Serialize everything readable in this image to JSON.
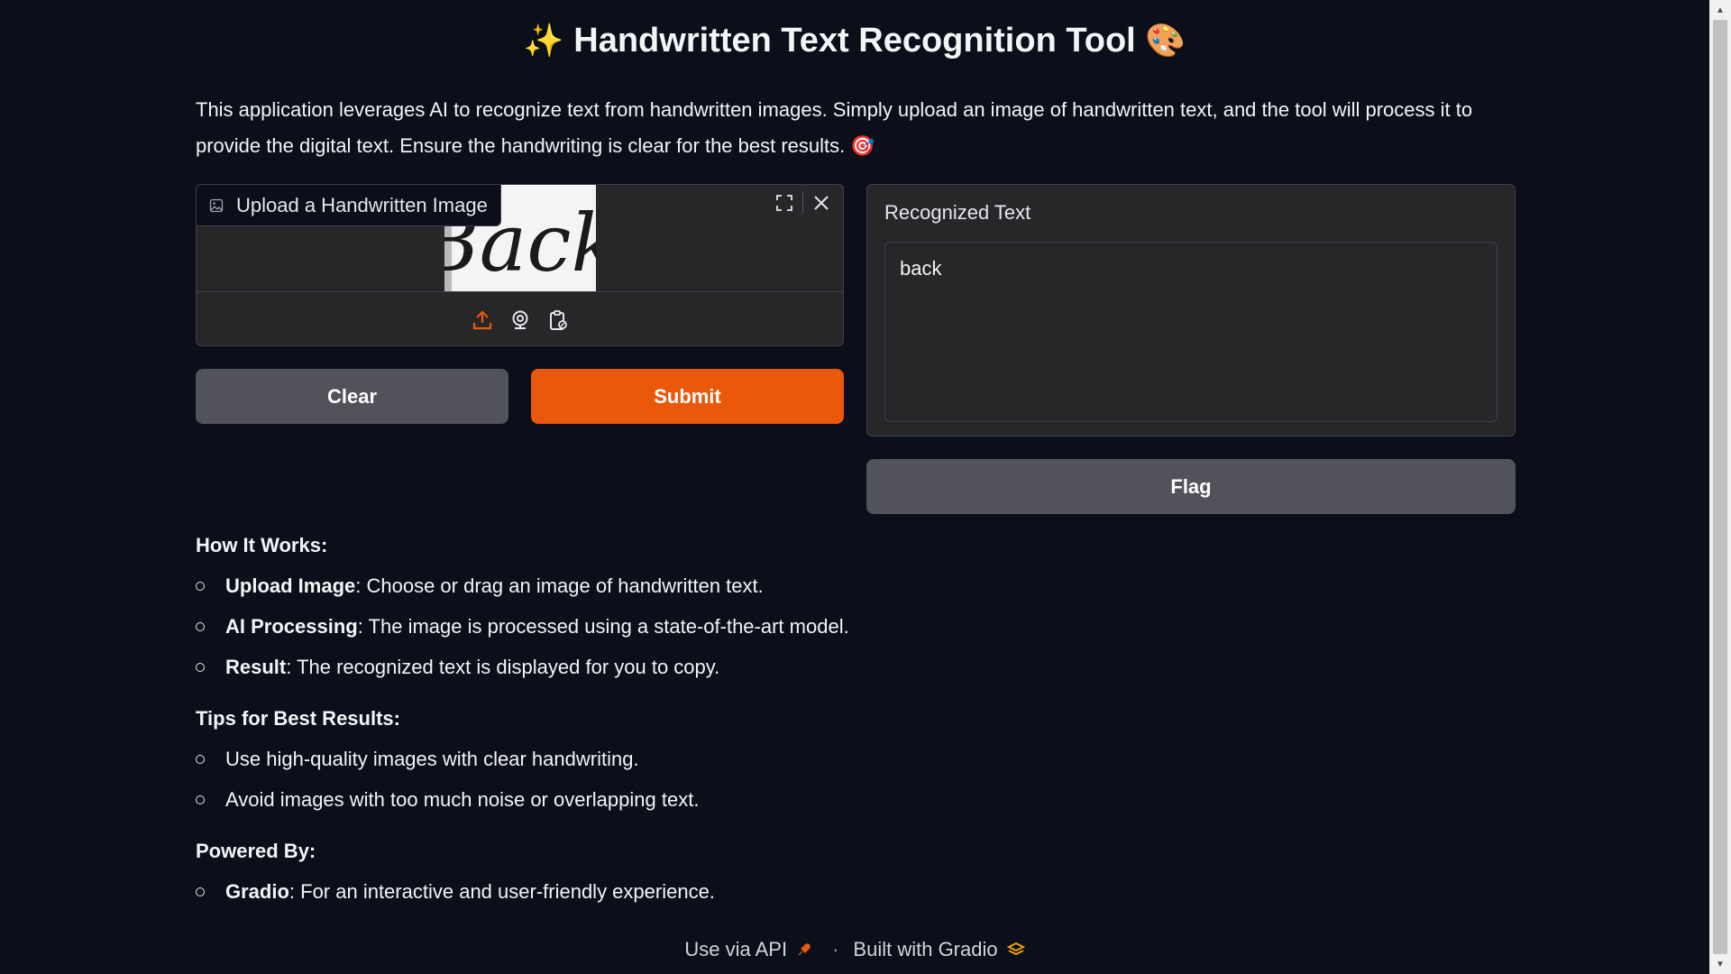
{
  "header": {
    "title": "Handwritten Text Recognition Tool",
    "title_emoji_left": "✨",
    "title_emoji_right": "🎨",
    "description": "This application leverages AI to recognize text from handwritten images. Simply upload an image of handwritten text, and the tool will process it to provide the digital text. Ensure the handwriting is clear for the best results. 🎯"
  },
  "upload": {
    "label": "Upload a Handwritten Image",
    "preview_text": "Back",
    "icons": [
      "image-icon",
      "fullscreen-icon",
      "close-icon",
      "upload-icon",
      "webcam-icon",
      "clipboard-icon"
    ]
  },
  "buttons": {
    "clear": "Clear",
    "submit": "Submit",
    "flag": "Flag"
  },
  "output": {
    "label": "Recognized Text",
    "value": "back"
  },
  "info": {
    "how_heading": "How It Works:",
    "how_items": [
      {
        "bold": "Upload Image",
        "text": ": Choose or drag an image of handwritten text."
      },
      {
        "bold": "AI Processing",
        "text": ": The image is processed using a state-of-the-art model."
      },
      {
        "bold": "Result",
        "text": ": The recognized text is displayed for you to copy."
      }
    ],
    "tips_heading": "Tips for Best Results:",
    "tips_items": [
      "Use high-quality images with clear handwriting.",
      "Avoid images with too much noise or overlapping text."
    ],
    "powered_heading": "Powered By:",
    "powered_items": [
      {
        "bold": "Gradio",
        "text": ": For an interactive and user-friendly experience."
      }
    ]
  },
  "footer": {
    "api": "Use via API",
    "separator": "·",
    "built": "Built with Gradio"
  },
  "colors": {
    "background": "#0b0f19",
    "accent": "#ea580c",
    "button_secondary": "#52525b",
    "panel": "#27272a"
  }
}
